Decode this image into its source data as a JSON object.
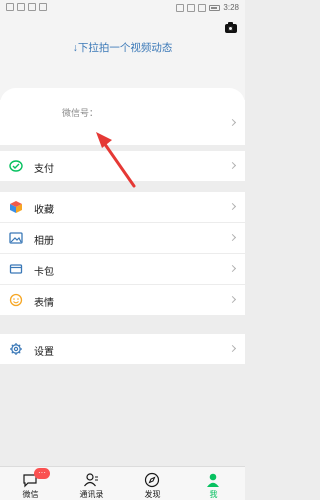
{
  "status_bar": {
    "time": "3:28"
  },
  "header": {
    "pull_hint": "↓下拉拍一个视频动态",
    "camera_icon": "camera-icon"
  },
  "profile": {
    "wechat_id_label": "微信号："
  },
  "menu": {
    "items": [
      {
        "label": "支付",
        "icon": "wechat-pay-icon",
        "color": "#07c160"
      },
      {
        "label": "收藏",
        "icon": "favorites-cube-icon",
        "color": "#f6a623"
      },
      {
        "label": "相册",
        "icon": "album-icon",
        "color": "#3a78b7"
      },
      {
        "label": "卡包",
        "icon": "card-wallet-icon",
        "color": "#3a78b7"
      },
      {
        "label": "表情",
        "icon": "sticker-smile-icon",
        "color": "#f6a623"
      },
      {
        "label": "设置",
        "icon": "settings-gear-icon",
        "color": "#3a78b7"
      }
    ]
  },
  "annotation": {
    "arrow_color": "#e53935"
  },
  "tab_bar": {
    "tabs": [
      {
        "label": "微信",
        "badge": "···"
      },
      {
        "label": "通讯录"
      },
      {
        "label": "发现"
      },
      {
        "label": "我",
        "active": true
      }
    ],
    "active_color": "#07c160"
  }
}
